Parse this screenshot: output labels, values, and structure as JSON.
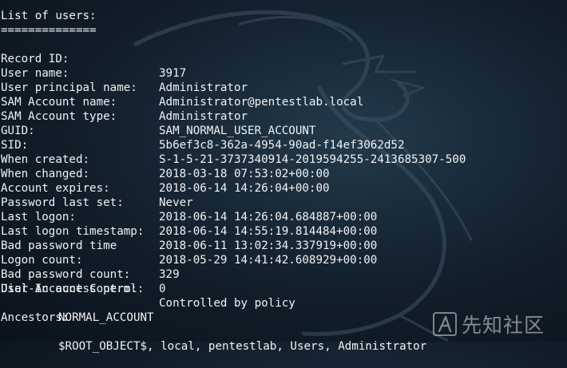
{
  "terminal": {
    "header": "List of users:",
    "separator": "==============",
    "fields": [
      {
        "key": "Record ID:",
        "value": "3917"
      },
      {
        "key": "User name:",
        "value": "Administrator"
      },
      {
        "key": "User principal name:",
        "value": "Administrator@pentestlab.local"
      },
      {
        "key": "SAM Account name:",
        "value": "Administrator"
      },
      {
        "key": "SAM Account type:",
        "value": "SAM_NORMAL_USER_ACCOUNT"
      },
      {
        "key": "GUID:",
        "value": "5b6ef3c8-362a-4954-90ad-f14ef3062d52"
      },
      {
        "key": "SID:",
        "value": "S-1-5-21-3737340914-2019594255-2413685307-500"
      },
      {
        "key": "When created:",
        "value": "2018-03-18 07:53:02+00:00"
      },
      {
        "key": "When changed:",
        "value": "2018-06-14 14:26:04+00:00"
      },
      {
        "key": "Account expires:",
        "value": "Never"
      },
      {
        "key": "Password last set:",
        "value": "2018-06-14 14:26:04.684887+00:00"
      },
      {
        "key": "Last logon:",
        "value": "2018-06-14 14:55:19.814484+00:00"
      },
      {
        "key": "Last logon timestamp:",
        "value": "2018-06-11 13:02:34.337919+00:00"
      },
      {
        "key": "Bad password time",
        "value": "2018-05-29 14:41:42.608929+00:00"
      },
      {
        "key": "Logon count:",
        "value": "329"
      },
      {
        "key": "Bad password count:",
        "value": "0"
      },
      {
        "key": "Dial-In access perm:",
        "value": "Controlled by policy"
      }
    ],
    "uac_label": "User Account Control:",
    "uac_value": "NORMAL_ACCOUNT",
    "ancestors_label": "Ancestors:",
    "ancestors_value": "$ROOT_OBJECT$, local, pentestlab, Users, Administrator"
  },
  "watermark": {
    "text": "先知社区",
    "icon": "xianzhi-logo-icon"
  },
  "background": {
    "icon": "kali-dragon-icon",
    "base_color": "#12202c"
  }
}
